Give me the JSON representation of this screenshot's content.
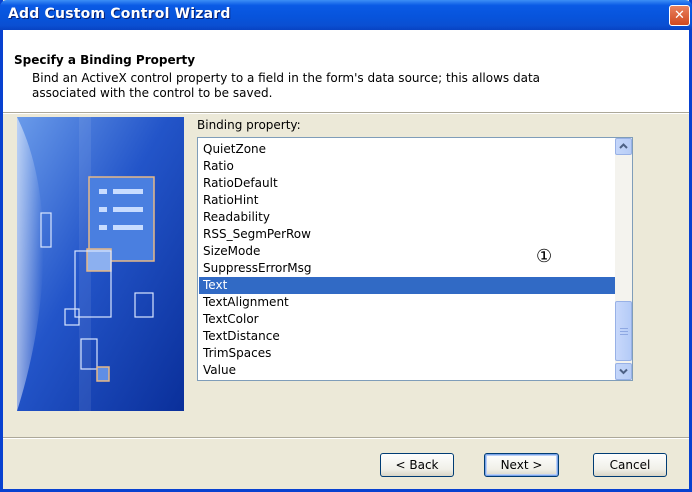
{
  "window": {
    "title": "Add Custom Control Wizard",
    "close_glyph": "✕"
  },
  "header": {
    "title": "Specify a Binding Property",
    "description": "Bind an ActiveX control property to a field in the form's data source; this allows data associated with the control to be saved."
  },
  "binding": {
    "label": "Binding property:",
    "items": [
      "QuietZone",
      "Ratio",
      "RatioDefault",
      "RatioHint",
      "Readability",
      "RSS_SegmPerRow",
      "SizeMode",
      "SuppressErrorMsg",
      "Text",
      "TextAlignment",
      "TextColor",
      "TextDistance",
      "TrimSpaces",
      "Value"
    ],
    "selected": "Text",
    "annotation": "①"
  },
  "buttons": {
    "back": "< Back",
    "next": "Next >",
    "cancel": "Cancel"
  },
  "icons": {
    "scroll_up": "chevron-up-icon",
    "scroll_down": "chevron-down-icon",
    "close": "close-icon"
  },
  "colors": {
    "titlebar": "#0754dc",
    "selection": "#316ac5",
    "dialog_bg": "#ece9d8"
  }
}
